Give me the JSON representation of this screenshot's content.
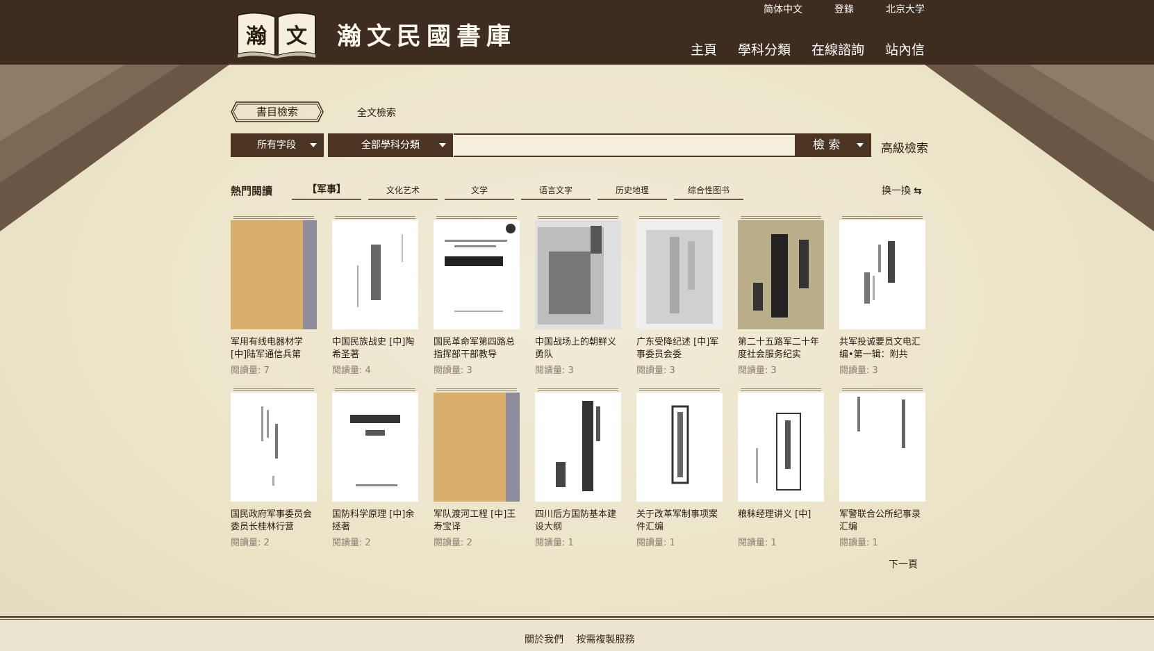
{
  "header": {
    "site_title": "瀚文民國書庫",
    "logo_text": "瀚文",
    "top_links": [
      "简体中文",
      "登錄",
      "北京大学"
    ],
    "nav": [
      "主頁",
      "學科分類",
      "在線諮詢",
      "站內信"
    ]
  },
  "search": {
    "tabs": [
      "書目檢索",
      "全文檢索"
    ],
    "field_select": "所有字段",
    "category_select": "全部學科分類",
    "query": "",
    "button": "檢 索",
    "advanced": "高級檢索"
  },
  "hot": {
    "label": "熱門閱讀",
    "categories": [
      "【军事】",
      "文化艺术",
      "文学",
      "语言文字",
      "历史地理",
      "综合性图书"
    ],
    "refresh": "换一換"
  },
  "books": [
    {
      "title": "军用有线电器材学 [中]陆军通信兵第",
      "reads": "閱讀量: 7"
    },
    {
      "title": "中国民族战史 [中]陶希圣著",
      "reads": "閱讀量: 4"
    },
    {
      "title": "国民革命军第四路总指挥部干部教导",
      "reads": "閱讀量: 3"
    },
    {
      "title": "中国战场上的朝鲜义勇队",
      "reads": "閱讀量: 3"
    },
    {
      "title": "广东受降纪述 [中]军事委员会委",
      "reads": "閱讀量: 3"
    },
    {
      "title": "第二十五路军二十年度社会服务纪实",
      "reads": "閱讀量: 3"
    },
    {
      "title": "共军投诚要员文电汇编•第一辑：附共",
      "reads": "閱讀量: 3"
    },
    {
      "title": "国民政府军事委员会委员长桂林行营",
      "reads": "閱讀量: 2"
    },
    {
      "title": "国防科学原理 [中]余拯著",
      "reads": "閱讀量: 2"
    },
    {
      "title": "军队渡河工程 [中]王寿宝译",
      "reads": "閱讀量: 2"
    },
    {
      "title": "四川后方国防基本建设大纲",
      "reads": "閱讀量: 1"
    },
    {
      "title": "关于改革军制事项案件汇编",
      "reads": "閱讀量: 1"
    },
    {
      "title": "粮秣经理讲义 [中]",
      "reads": "閱讀量: 1"
    },
    {
      "title": "军警联合公所纪事录汇编",
      "reads": "閱讀量: 1"
    }
  ],
  "pagination": {
    "next": "下一頁"
  },
  "footer": {
    "links": [
      "關於我們",
      "按需複製服務"
    ]
  },
  "colors": {
    "header_bg": "#3f2c20",
    "control_bg": "#4b3422",
    "parchment": "#efe9d2"
  }
}
